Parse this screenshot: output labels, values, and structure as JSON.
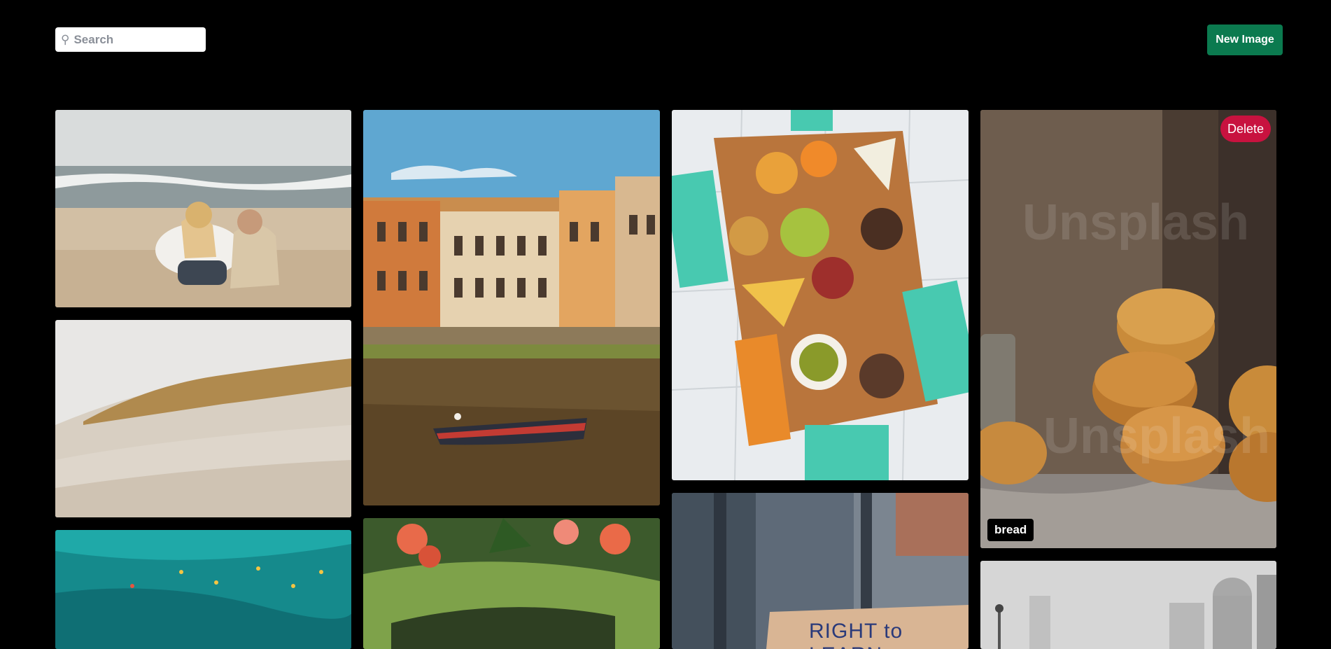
{
  "toolbar": {
    "search_placeholder": "Search",
    "search_icon": "magnifier-icon",
    "new_image_label": "New Image",
    "new_image_color": "#0b7a4f"
  },
  "gallery": {
    "delete_label": "Delete",
    "delete_color": "#c8123f",
    "images": [
      {
        "subject": "couple-on-beach"
      },
      {
        "subject": "snowy-dune"
      },
      {
        "subject": "turquoise-water"
      },
      {
        "subject": "florence-river-boat"
      },
      {
        "subject": "garden-flowers"
      },
      {
        "subject": "charcuterie-board"
      },
      {
        "subject": "protest-sign"
      },
      {
        "subject": "bread-buns",
        "label": "bread",
        "watermark": "Unsplash"
      },
      {
        "subject": "foggy-city"
      }
    ],
    "sign_text": "RIGHT to LEARN"
  }
}
